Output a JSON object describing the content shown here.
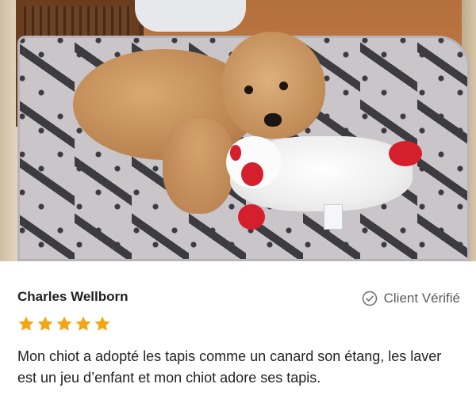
{
  "review": {
    "reviewer_name": "Charles Wellborn",
    "verified_label": "Client Vérifié",
    "rating": 5,
    "rating_max": 5,
    "star_color": "#f3a512",
    "text": "Mon chiot a adopté les tapis comme un canard son étang, les laver est un jeu d’enfant et mon chiot adore ses tapis."
  },
  "icons": {
    "verified": "check-circle-icon",
    "rating": "star-icon"
  }
}
